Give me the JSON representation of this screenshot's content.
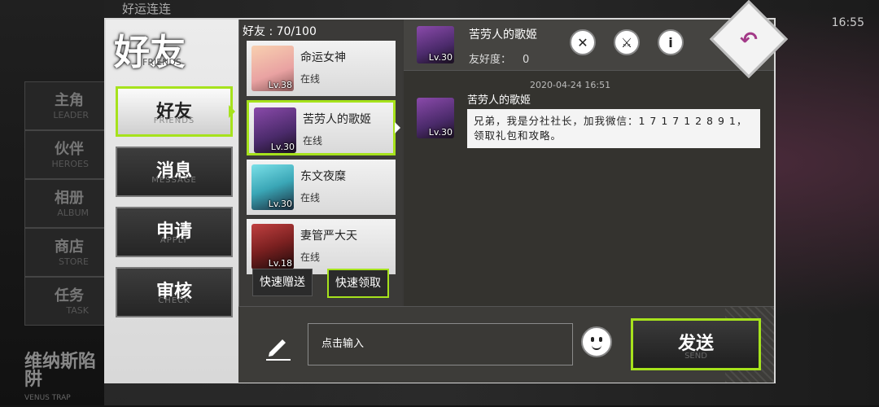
{
  "background": {
    "top_text": "好运连连",
    "clock": "16:55",
    "nav": [
      {
        "zh": "主角",
        "en": "LEADER"
      },
      {
        "zh": "伙伴",
        "en": "HEROES"
      },
      {
        "zh": "相册",
        "en": "ALBUM"
      },
      {
        "zh": "商店",
        "en": "STORE"
      },
      {
        "zh": "任务",
        "en": "TASK"
      }
    ],
    "event_zh": "维纳斯陷阱",
    "event_en": "VENUS TRAP"
  },
  "panel": {
    "title": "好友",
    "title_en": "FRIENDS",
    "tabs": [
      {
        "zh": "好友",
        "en": "FRIENDS",
        "active": true
      },
      {
        "zh": "消息",
        "en": "MESSAGE",
        "active": false
      },
      {
        "zh": "申请",
        "en": "APPLY",
        "active": false
      },
      {
        "zh": "审核",
        "en": "CHECK",
        "active": false
      }
    ]
  },
  "friends": {
    "count_label": "好友 : 70/100",
    "items": [
      {
        "name": "命运女神",
        "status": "在线",
        "level": "Lv.38",
        "color": "#e9a2a2"
      },
      {
        "name": "苦劳人的歌姬",
        "status": "在线",
        "level": "Lv.30",
        "color": "#6a3a8a"
      },
      {
        "name": "东文夜糜",
        "status": "在线",
        "level": "Lv.30",
        "color": "#3aa6b6"
      },
      {
        "name": "妻管严大天",
        "status": "在线",
        "level": "Lv.18",
        "color": "#7a2020"
      }
    ],
    "quick_send": "快速赠送",
    "quick_receive": "快速领取"
  },
  "chat": {
    "name": "苦劳人的歌姬",
    "level": "Lv.30",
    "favor_label": "友好度：",
    "favor_value": "0",
    "timestamp": "2020-04-24 16:51",
    "message_sender": "苦劳人的歌姬",
    "message_text": "兄弟，我是分社社长，加我微信：1 7 1 7 1 2 8 9 1，领取礼包和攻略。",
    "icons": [
      "close-icon",
      "sword-icon",
      "info-icon"
    ]
  },
  "input": {
    "placeholder": "点击输入",
    "send_label": "发送",
    "send_en": "SEND"
  }
}
